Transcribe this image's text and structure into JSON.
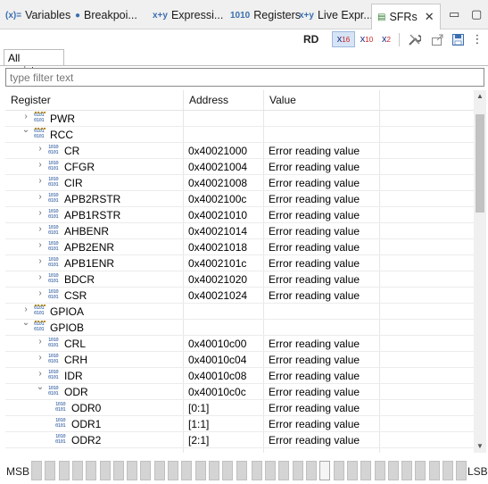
{
  "tabs": [
    {
      "icon": "(x)=",
      "label": "Variables"
    },
    {
      "icon": "●",
      "label": "Breakpoi..."
    },
    {
      "icon": "x+y",
      "label": "Expressi..."
    },
    {
      "icon": "1010",
      "label": "Registers"
    },
    {
      "icon": "x+y",
      "label": "Live Expr..."
    },
    {
      "icon": "▤",
      "label": "SFRs"
    }
  ],
  "toolbar": {
    "rd": "RD",
    "x16": "x",
    "x16_sub": "16",
    "x10": "x",
    "x10_sub": "10",
    "x2": "x",
    "x2_sub": "2"
  },
  "inner_tab": "All registers",
  "filter": {
    "placeholder": "type filter text",
    "value": ""
  },
  "columns": {
    "register": "Register",
    "address": "Address",
    "value": "Value"
  },
  "rows": [
    {
      "depth": 0,
      "chevron": "›",
      "icon": "peripheral",
      "name": "PWR",
      "address": "",
      "value": ""
    },
    {
      "depth": 0,
      "chevron": "⌄",
      "icon": "peripheral",
      "name": "RCC",
      "address": "",
      "value": ""
    },
    {
      "depth": 1,
      "chevron": "›",
      "icon": "register",
      "name": "CR",
      "address": "0x40021000",
      "value": "Error reading value"
    },
    {
      "depth": 1,
      "chevron": "›",
      "icon": "register",
      "name": "CFGR",
      "address": "0x40021004",
      "value": "Error reading value"
    },
    {
      "depth": 1,
      "chevron": "›",
      "icon": "register",
      "name": "CIR",
      "address": "0x40021008",
      "value": "Error reading value"
    },
    {
      "depth": 1,
      "chevron": "›",
      "icon": "register",
      "name": "APB2RSTR",
      "address": "0x4002100c",
      "value": "Error reading value"
    },
    {
      "depth": 1,
      "chevron": "›",
      "icon": "register",
      "name": "APB1RSTR",
      "address": "0x40021010",
      "value": "Error reading value"
    },
    {
      "depth": 1,
      "chevron": "›",
      "icon": "register",
      "name": "AHBENR",
      "address": "0x40021014",
      "value": "Error reading value"
    },
    {
      "depth": 1,
      "chevron": "›",
      "icon": "register",
      "name": "APB2ENR",
      "address": "0x40021018",
      "value": "Error reading value"
    },
    {
      "depth": 1,
      "chevron": "›",
      "icon": "register",
      "name": "APB1ENR",
      "address": "0x4002101c",
      "value": "Error reading value"
    },
    {
      "depth": 1,
      "chevron": "›",
      "icon": "register",
      "name": "BDCR",
      "address": "0x40021020",
      "value": "Error reading value"
    },
    {
      "depth": 1,
      "chevron": "›",
      "icon": "register",
      "name": "CSR",
      "address": "0x40021024",
      "value": "Error reading value"
    },
    {
      "depth": 0,
      "chevron": "›",
      "icon": "peripheral",
      "name": "GPIOA",
      "address": "",
      "value": ""
    },
    {
      "depth": 0,
      "chevron": "⌄",
      "icon": "peripheral",
      "name": "GPIOB",
      "address": "",
      "value": ""
    },
    {
      "depth": 1,
      "chevron": "›",
      "icon": "register",
      "name": "CRL",
      "address": "0x40010c00",
      "value": "Error reading value"
    },
    {
      "depth": 1,
      "chevron": "›",
      "icon": "register",
      "name": "CRH",
      "address": "0x40010c04",
      "value": "Error reading value"
    },
    {
      "depth": 1,
      "chevron": "›",
      "icon": "register",
      "name": "IDR",
      "address": "0x40010c08",
      "value": "Error reading value"
    },
    {
      "depth": 1,
      "chevron": "⌄",
      "icon": "register",
      "name": "ODR",
      "address": "0x40010c0c",
      "value": "Error reading value"
    },
    {
      "depth": 2,
      "chevron": "",
      "icon": "field",
      "name": "ODR0",
      "address": "[0:1]",
      "value": "Error reading value"
    },
    {
      "depth": 2,
      "chevron": "",
      "icon": "field",
      "name": "ODR1",
      "address": "[1:1]",
      "value": "Error reading value"
    },
    {
      "depth": 2,
      "chevron": "",
      "icon": "field",
      "name": "ODR2",
      "address": "[2:1]",
      "value": "Error reading value"
    }
  ],
  "bitbar": {
    "msb": "MSB",
    "lsb": "LSB",
    "bit_count": 32,
    "highlighted_bit_index": 21
  }
}
